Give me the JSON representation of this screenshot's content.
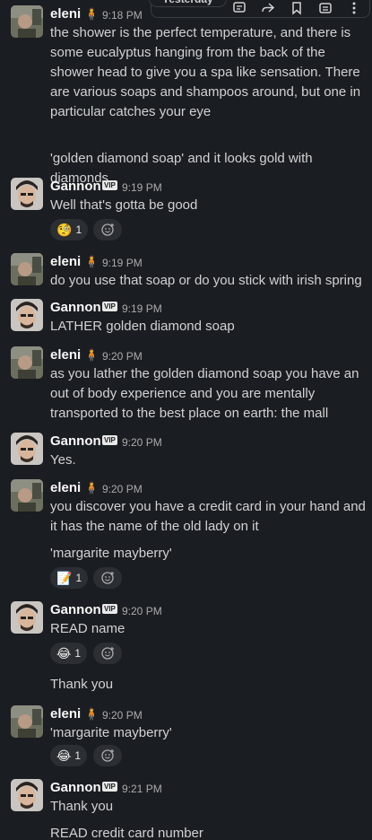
{
  "day_divider": "Yesterday",
  "toolbar": {
    "icons": [
      "thread-icon",
      "forward-icon",
      "bookmark-icon",
      "more-actions-icon",
      "kebab-icon"
    ]
  },
  "users": {
    "eleni": {
      "name": "eleni",
      "badge": "🧍"
    },
    "gannon": {
      "name": "Gannon",
      "badge": "VIP"
    }
  },
  "messages": [
    {
      "author": "eleni",
      "time": "9:18 PM",
      "text": "the shower is the perfect temperature, and there is some eucalyptus hanging from the back of the shower head to give you a spa like sensation. There are various soaps and shampoos around, but one in particular catches your eye",
      "continuation": "'golden diamond soap' and it looks gold with diamonds"
    },
    {
      "author": "Gannon",
      "time": "9:19 PM",
      "text": "Well that's gotta be good",
      "reaction": {
        "emoji": "🧐",
        "count": "1"
      }
    },
    {
      "author": "eleni",
      "time": "9:19 PM",
      "text": "do you use that soap or do you stick with irish spring"
    },
    {
      "author": "Gannon",
      "time": "9:19 PM",
      "text": "LATHER golden diamond soap"
    },
    {
      "author": "eleni",
      "time": "9:20 PM",
      "text": "as you lather the golden diamond soap you have an out of body experience and you are mentally transported to the best place on earth: the mall"
    },
    {
      "author": "Gannon",
      "time": "9:20 PM",
      "text": "Yes."
    },
    {
      "author": "eleni",
      "time": "9:20 PM",
      "text": "you discover you have a credit card in your hand and it has the name of the old lady on it",
      "continuation": "'margarite mayberry'",
      "reaction": {
        "emoji": "📝",
        "count": "1"
      }
    },
    {
      "author": "Gannon",
      "time": "9:20 PM",
      "text": "READ name",
      "reaction": {
        "emoji": "😂",
        "count": "1"
      },
      "continuation": "Thank you"
    },
    {
      "author": "eleni",
      "time": "9:20 PM",
      "text": "'margarite mayberry'",
      "reaction": {
        "emoji": "😂",
        "count": "1"
      }
    },
    {
      "author": "Gannon",
      "time": "9:21 PM",
      "text": "Thank you",
      "continuation": "READ credit card number"
    }
  ],
  "colors": {
    "background": "#1a1d21",
    "reaction_bg": "#2b2e33",
    "text": "#d1d2d3",
    "author": "#f8f8f8",
    "time": "#ababad"
  }
}
